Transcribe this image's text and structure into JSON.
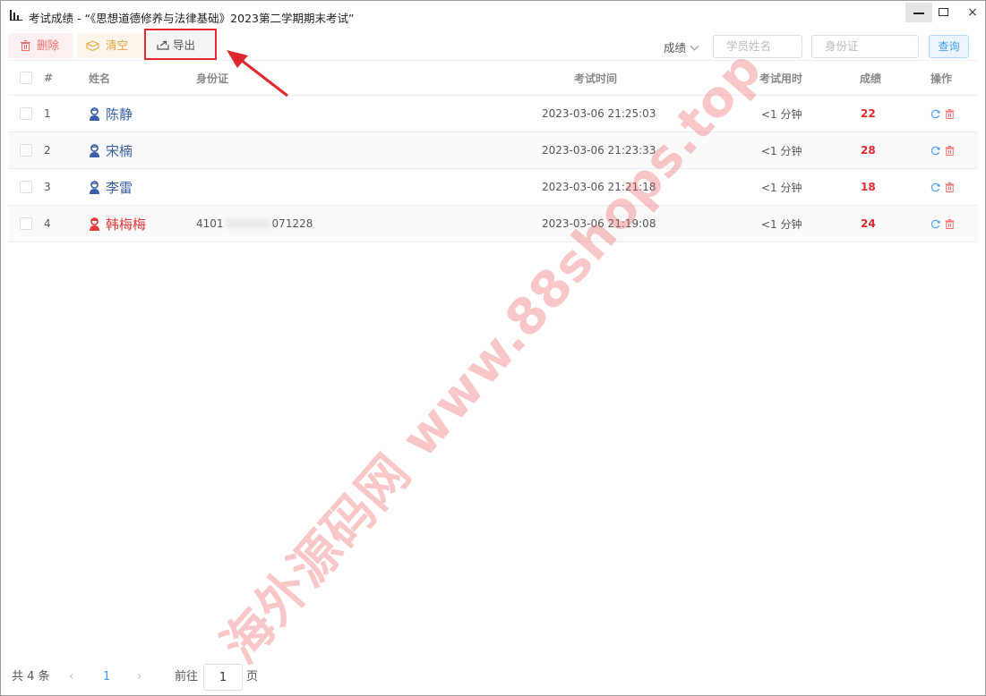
{
  "window": {
    "title": "考试成绩 -  “《思想道德修养与法律基础》2023第二学期期末考试”",
    "close_glyph": "×"
  },
  "toolbar": {
    "delete_label": "删除",
    "clear_label": "清空",
    "export_label": "导出",
    "sort_label": "成绩",
    "name_placeholder": "学员姓名",
    "id_placeholder": "身份证",
    "query_label": "查询"
  },
  "table": {
    "headers": {
      "index": "#",
      "name": "姓名",
      "id_card": "身份证",
      "exam_time": "考试时间",
      "duration": "考试用时",
      "score": "成绩",
      "actions": "操作"
    },
    "rows": [
      {
        "index": "1",
        "name": "陈静",
        "gender": "male",
        "id_prefix": "",
        "id_suffix": "",
        "exam_time": "2023-03-06 21:25:03",
        "duration": "<1 分钟",
        "score": "22"
      },
      {
        "index": "2",
        "name": "宋楠",
        "gender": "male",
        "id_prefix": "",
        "id_suffix": "",
        "exam_time": "2023-03-06 21:23:33",
        "duration": "<1 分钟",
        "score": "28"
      },
      {
        "index": "3",
        "name": "李雷",
        "gender": "male",
        "id_prefix": "",
        "id_suffix": "",
        "exam_time": "2023-03-06 21:21:18",
        "duration": "<1 分钟",
        "score": "18"
      },
      {
        "index": "4",
        "name": "韩梅梅",
        "gender": "female",
        "id_prefix": "4101",
        "id_suffix": "071228",
        "exam_time": "2023-03-06 21:19:08",
        "duration": "<1 分钟",
        "score": "24"
      }
    ]
  },
  "pagination": {
    "total": "共 4 条",
    "prev": "‹",
    "current_page": "1",
    "next": "›",
    "goto_label": "前往",
    "goto_value": "1",
    "page_suffix": "页"
  },
  "watermark": {
    "text": "海外源码网 www.88shops.top"
  },
  "colors": {
    "score": "#e0282e",
    "annotation": "#e0282e",
    "link": "#409eff"
  }
}
